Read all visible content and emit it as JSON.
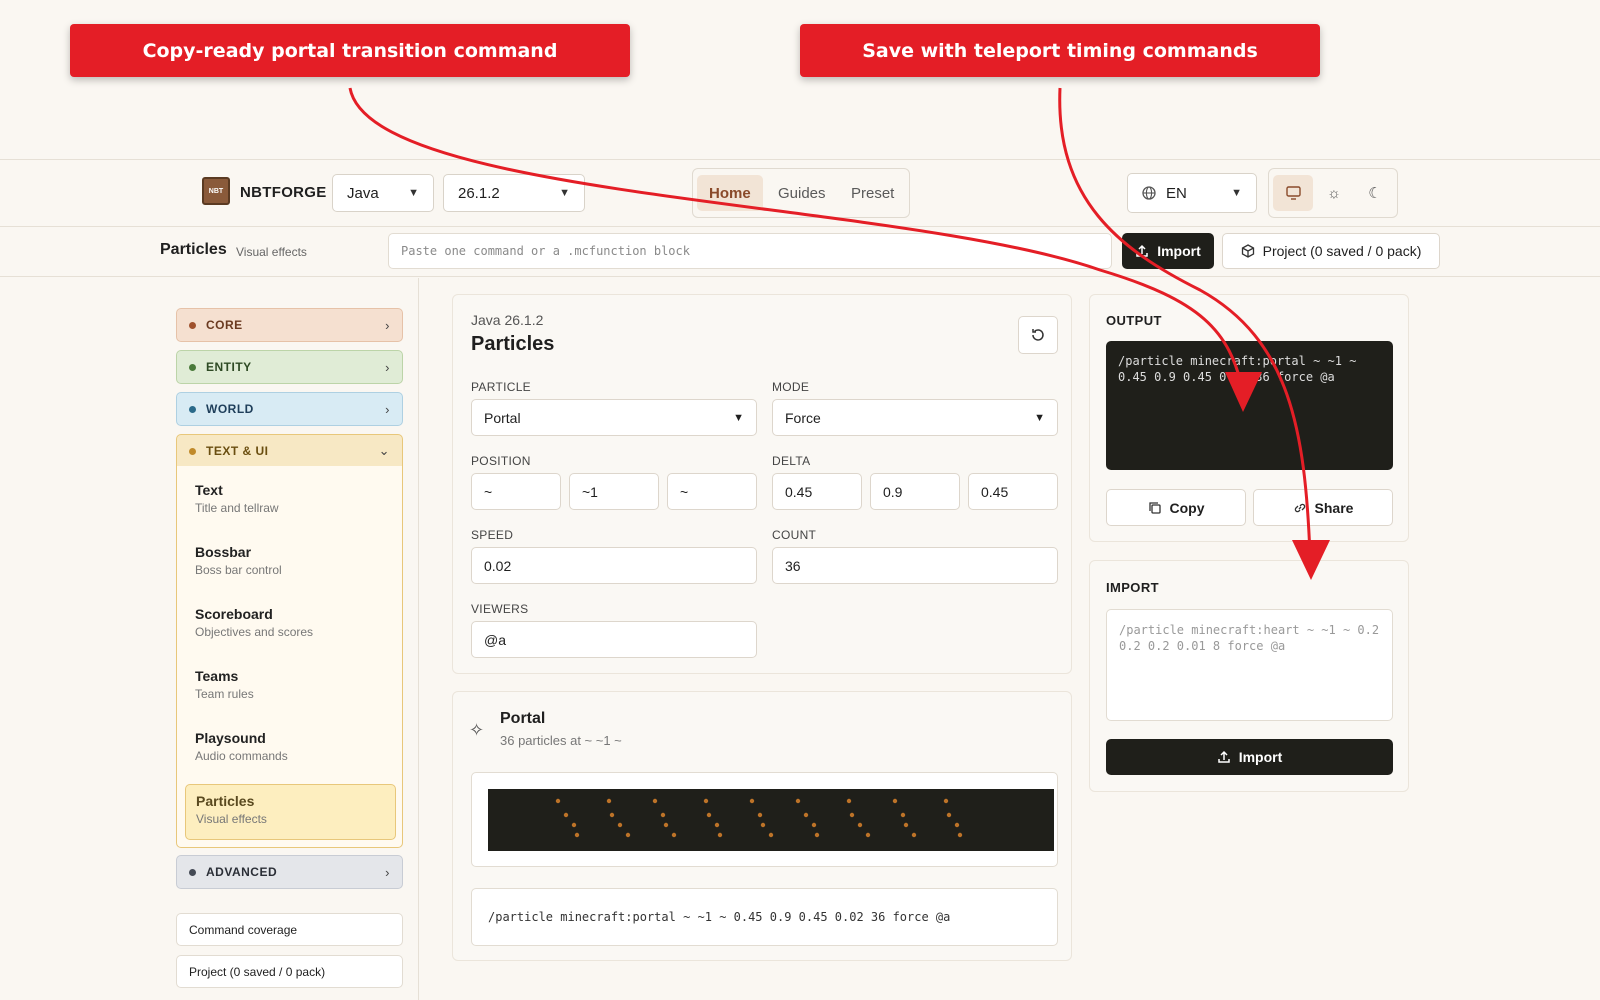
{
  "callouts": {
    "left": "Copy-ready portal transition command",
    "right": "Save with teleport timing commands"
  },
  "header": {
    "logo_text": "NBT",
    "brand": "NBTFORGE",
    "edition": "Java",
    "version": "26.1.2",
    "nav": [
      "Home",
      "Guides",
      "Preset"
    ],
    "language": "EN"
  },
  "subbar": {
    "title": "Particles",
    "subtitle": "Visual effects",
    "paste_placeholder": "Paste one command or a .mcfunction block",
    "import_label": "Import",
    "project_label": "Project (0 saved / 0 pack)"
  },
  "sidebar": {
    "categories": [
      {
        "label": "CORE",
        "color": "#a0522d"
      },
      {
        "label": "ENTITY",
        "color": "#4a7a3a"
      },
      {
        "label": "WORLD",
        "color": "#2a6a8a"
      },
      {
        "label": "TEXT & UI",
        "color": "#8a6a1a"
      },
      {
        "label": "ADVANCED",
        "color": "#444a55"
      }
    ],
    "items": [
      {
        "title": "Text",
        "desc": "Title and tellraw"
      },
      {
        "title": "Bossbar",
        "desc": "Boss bar control"
      },
      {
        "title": "Scoreboard",
        "desc": "Objectives and scores"
      },
      {
        "title": "Teams",
        "desc": "Team rules"
      },
      {
        "title": "Playsound",
        "desc": "Audio commands"
      },
      {
        "title": "Particles",
        "desc": "Visual effects"
      }
    ],
    "coverage": "Command coverage",
    "project": "Project (0 saved / 0 pack)"
  },
  "editor": {
    "edition_version": "Java 26.1.2",
    "title": "Particles",
    "particle_label": "PARTICLE",
    "particle_value": "Portal",
    "mode_label": "MODE",
    "mode_value": "Force",
    "position_label": "POSITION",
    "position": [
      "~",
      "~1",
      "~"
    ],
    "delta_label": "DELTA",
    "delta": [
      "0.45",
      "0.9",
      "0.45"
    ],
    "speed_label": "SPEED",
    "speed": "0.02",
    "count_label": "COUNT",
    "count": "36",
    "viewers_label": "VIEWERS",
    "viewers": "@a"
  },
  "preview": {
    "title": "Portal",
    "subtitle": "36 particles at ~ ~1 ~",
    "command": "/particle minecraft:portal ~ ~1 ~ 0.45 0.9 0.45 0.02 36 force @a"
  },
  "output": {
    "label": "OUTPUT",
    "command": "/particle minecraft:portal ~ ~1 ~ 0.45 0.9 0.45 0.02 36 force @a",
    "copy": "Copy",
    "share": "Share"
  },
  "import": {
    "label": "IMPORT",
    "placeholder": "/particle minecraft:heart ~ ~1 ~ 0.2 0.2 0.2 0.01 8 force @a",
    "button": "Import"
  }
}
